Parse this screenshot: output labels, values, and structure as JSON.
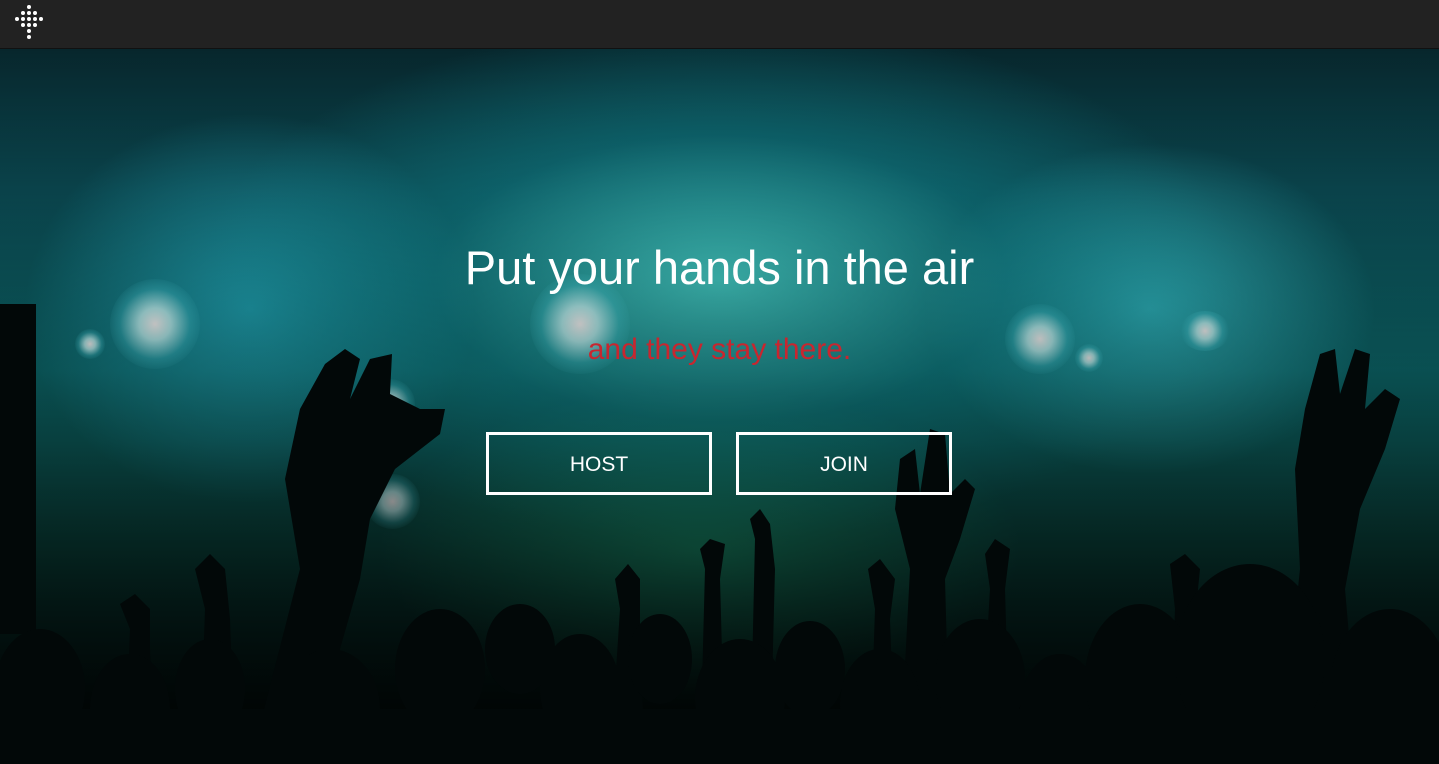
{
  "app": {
    "logo_icon": "dotted-cross-logo-icon"
  },
  "hero": {
    "headline": "Put your hands in the air",
    "subline": "and they stay there.",
    "background": "concert-crowd-image",
    "accent_color": "#c8262f"
  },
  "actions": {
    "host_label": "HOST",
    "join_label": "JOIN"
  }
}
